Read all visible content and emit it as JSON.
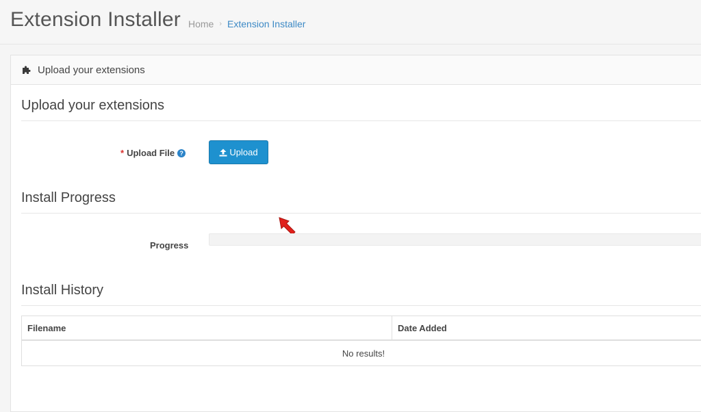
{
  "header": {
    "title": "Extension Installer",
    "breadcrumb": {
      "home": "Home",
      "separator": "›",
      "current": "Extension Installer"
    }
  },
  "panel": {
    "heading": "Upload your extensions",
    "heading_icon": "puzzle-icon"
  },
  "sections": {
    "upload": {
      "title": "Upload your extensions",
      "required_marker": "*",
      "field_label": "Upload File",
      "help_icon": "question-circle-icon",
      "button_label": "Upload",
      "button_icon": "upload-icon"
    },
    "progress": {
      "title": "Install Progress",
      "label": "Progress",
      "value": 0
    },
    "history": {
      "title": "Install History",
      "columns": [
        "Filename",
        "Date Added"
      ],
      "empty_text": "No results!"
    }
  },
  "colors": {
    "primary": "#1e91cf",
    "link": "#3c89c5",
    "required": "#d9302d",
    "annotation_arrow": "#e0201b"
  }
}
